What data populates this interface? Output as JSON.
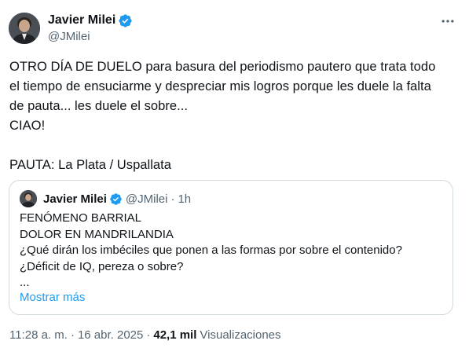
{
  "tweet": {
    "author_name": "Javier Milei",
    "author_handle": "@JMilei",
    "verified_icon": "verified-badge-icon",
    "lines": [
      "OTRO DÍA DE DUELO para basura del periodismo pautero que trata todo",
      "el tiempo de ensuciarme y despreciar mis logros porque les duele la falta",
      "de pauta... les duele el sobre...",
      "CIAO!",
      "",
      "PAUTA: La Plata / Uspallata"
    ]
  },
  "quote": {
    "author_name": "Javier Milei",
    "author_handle": "@JMilei",
    "separator": "·",
    "time": "1h",
    "lines": [
      "FENÓMENO BARRIAL",
      "DOLOR EN MANDRILANDIA",
      "¿Qué dirán los imbéciles que ponen a las formas por sobre el contenido?",
      "¿Déficit de IQ, pereza o sobre?",
      "..."
    ],
    "show_more": "Mostrar más"
  },
  "meta": {
    "time": "11:28 a. m.",
    "separator1": "·",
    "date": "16 abr. 2025",
    "separator2": "·",
    "views_count": "42,1 mil",
    "views_label": "Visualizaciones"
  },
  "colors": {
    "text": "#0f1419",
    "secondary": "#536471",
    "link": "#1d9bf0",
    "border": "#cfd9de",
    "verified": "#1d9bf0"
  }
}
